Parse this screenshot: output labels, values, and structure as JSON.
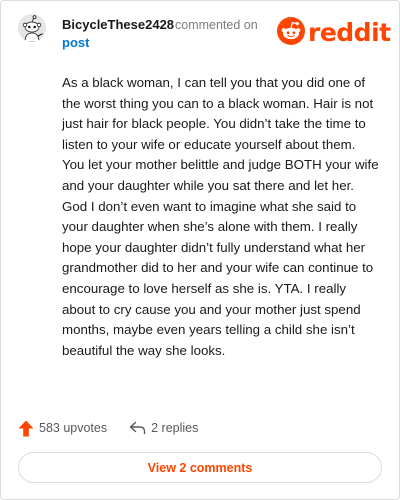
{
  "comment": {
    "username": "BicycleThese2428",
    "meta_text": "commented on",
    "post_link": "post",
    "avatar": "snoo-avatar-icon",
    "body": "As a black woman, I can tell you that you did one of the worst thing you can to a black woman. Hair is not just hair for black people. You didn’t take the time to listen to your wife or educate yourself about them. You let your mother belittle and judge BOTH your wife and your daughter while you sat there and let her. God I don’t even want to imagine what she said to your daughter when she’s alone with them. I really hope your daughter didn’t fully understand what her grandmother did to her and your wife can continue to encourage to love herself as she is. YTA. I really about to cry cause you and your mother just spend months, maybe even years telling a child she isn’t beautiful the way she looks."
  },
  "brand": {
    "logo_text": "reddit",
    "logo_icon": "reddit-snoo-icon",
    "color": "#ff4500"
  },
  "actions": {
    "upvotes": "583 upvotes",
    "upvote_icon": "upvote-arrow-icon",
    "replies": "2 replies",
    "reply_icon": "reply-arrow-icon"
  },
  "view_comments_label": "View 2 comments"
}
